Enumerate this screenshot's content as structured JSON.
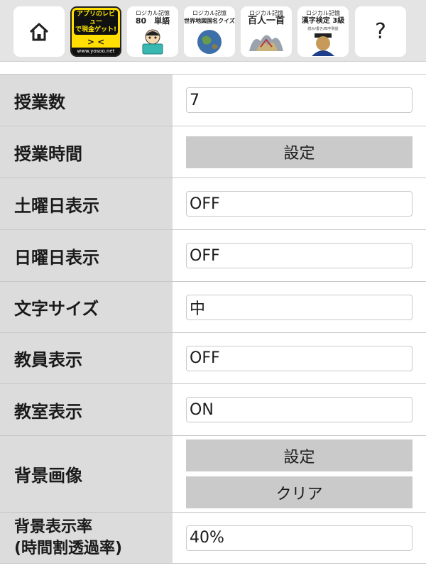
{
  "toolbar": {
    "help_label": "?",
    "apps": [
      {
        "name": "review-app",
        "lines": [
          "アプリのレビュー",
          "で現金ゲット!"
        ],
        "face": "> <",
        "footer": "www.yosoo.net"
      },
      {
        "name": "english-words-app",
        "title": "ロジカル記憶",
        "big": "80　単語"
      },
      {
        "name": "world-map-quiz-app",
        "title": "ロジカル記憶",
        "big": "世界地図国名クイズ"
      },
      {
        "name": "hyakunin-isshu-app",
        "title": "ロジカル記憶",
        "big": "百人一首"
      },
      {
        "name": "kanji-test-app",
        "title": "ロジカル記憶",
        "big": "漢字検定 3級",
        "sub": "読み/書き/四字熟語"
      }
    ]
  },
  "settings": [
    {
      "label": "授業数",
      "value": "7"
    },
    {
      "label": "授業時間",
      "button": "設定"
    },
    {
      "label": "土曜日表示",
      "value": "OFF"
    },
    {
      "label": "日曜日表示",
      "value": "OFF"
    },
    {
      "label": "文字サイズ",
      "value": "中"
    },
    {
      "label": "教員表示",
      "value": "OFF"
    },
    {
      "label": "教室表示",
      "value": "ON"
    },
    {
      "label": "背景画像",
      "buttons": [
        "設定",
        "クリア"
      ]
    },
    {
      "label_lines": [
        "背景表示率",
        "(時間割透過率)"
      ],
      "value": "40%"
    }
  ]
}
